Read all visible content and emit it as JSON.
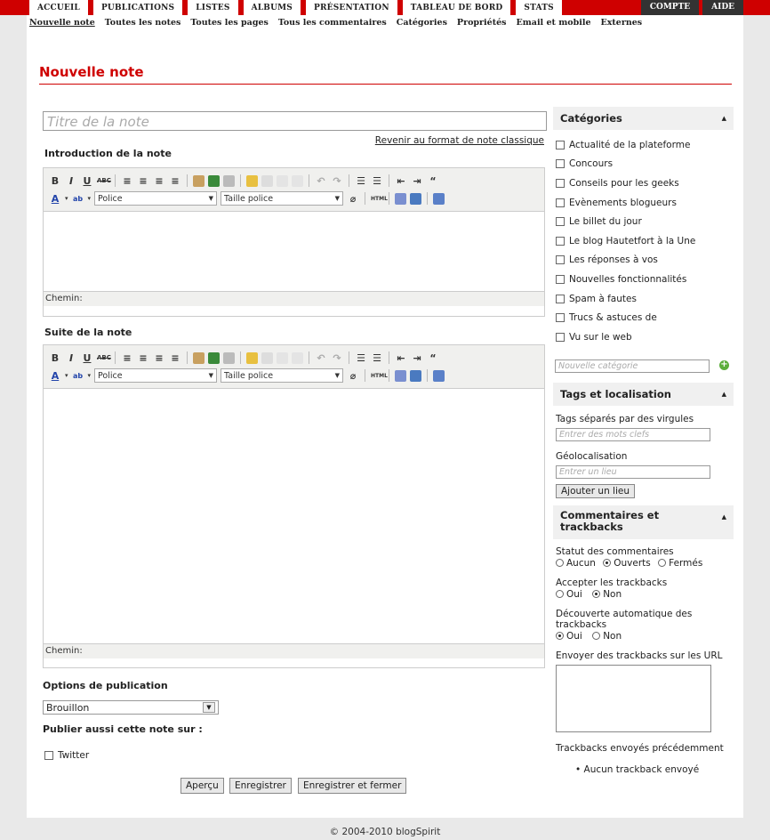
{
  "tabs": [
    "ACCUEIL",
    "PUBLICATIONS",
    "LISTES",
    "ALBUMS",
    "PRÉSENTATION",
    "TABLEAU DE BORD",
    "STATS"
  ],
  "tabs_right": [
    "COMPTE",
    "AIDE"
  ],
  "subnav": [
    "Nouvelle note",
    "Toutes les notes",
    "Toutes les pages",
    "Tous les commentaires",
    "Catégories",
    "Propriétés",
    "Email et mobile",
    "Externes"
  ],
  "page_title": "Nouvelle note",
  "title_placeholder": "Titre de la note",
  "classic_link": "Revenir au format de note classique",
  "intro_label": "Introduction de la note",
  "suite_label": "Suite de la note",
  "font_select": "Police",
  "size_select": "Taille police",
  "path_label": "Chemin:",
  "publish_options_label": "Options de publication",
  "status_value": "Brouillon",
  "publish_also_label": "Publier aussi cette note sur :",
  "twitter_label": "Twitter",
  "buttons": {
    "preview": "Aperçu",
    "save": "Enregistrer",
    "save_close": "Enregistrer et fermer"
  },
  "sidebar": {
    "categories_title": "Catégories",
    "categories": [
      "Actualité de la plateforme",
      "Concours",
      "Conseils pour les geeks",
      "Evènements blogueurs",
      "Le billet du jour",
      "Le blog Hautetfort à la Une",
      "Les réponses à vos",
      "Nouvelles fonctionnalités",
      "Spam à fautes",
      "Trucs & astuces de",
      "Vu sur le web"
    ],
    "new_category_placeholder": "Nouvelle catégorie",
    "tags_title": "Tags et localisation",
    "tags_label": "Tags séparés par des virgules",
    "tags_placeholder": "Entrer des mots clefs",
    "geo_label": "Géolocalisation",
    "geo_placeholder": "Entrer un lieu",
    "add_place": "Ajouter un lieu",
    "comments_title": "Commentaires et trackbacks",
    "comment_status_label": "Statut des commentaires",
    "comment_options": [
      "Aucun",
      "Ouverts",
      "Fermés"
    ],
    "accept_tb_label": "Accepter les trackbacks",
    "yes": "Oui",
    "no": "Non",
    "auto_tb_label": "Découverte automatique des trackbacks",
    "send_tb_label": "Envoyer des trackbacks sur les URL",
    "sent_tb_label": "Trackbacks envoyés précédemment",
    "no_tb": "Aucun trackback envoyé"
  },
  "footer": "© 2004-2010 blogSpirit"
}
